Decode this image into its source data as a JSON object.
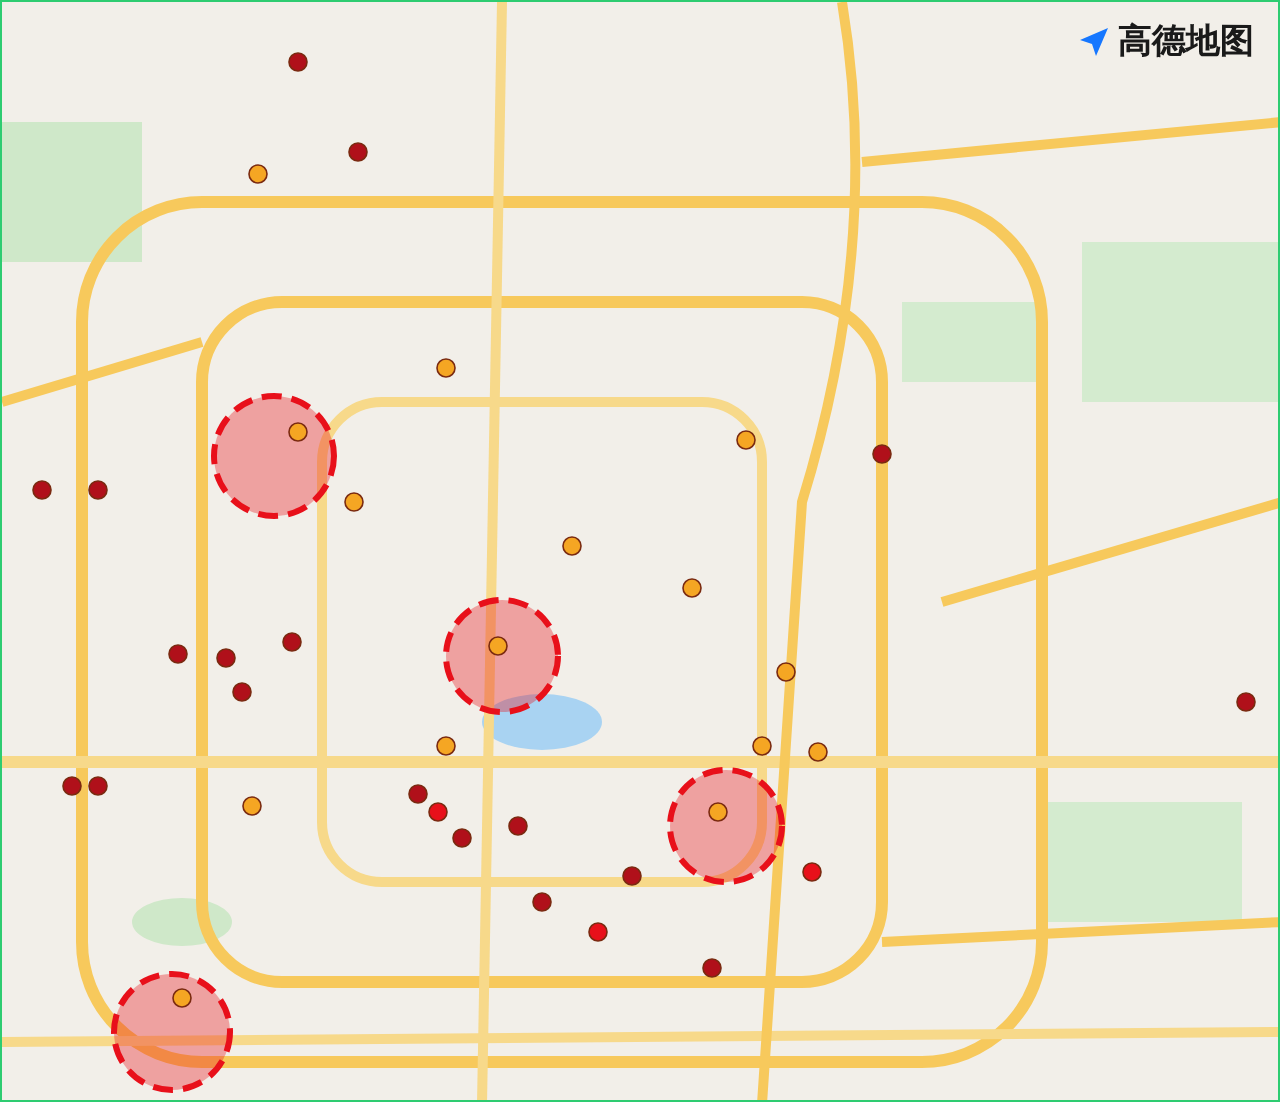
{
  "map": {
    "logo": {
      "text": "高德地图"
    },
    "markers": [
      {
        "kind": "cluster",
        "color": "#e8101a"
      },
      {
        "kind": "cluster",
        "color": "#e8101a"
      },
      {
        "kind": "cluster",
        "color": "#e8101a"
      },
      {
        "kind": "cluster",
        "color": "#e8101a"
      },
      {
        "kind": "dot",
        "color": "#b0101a"
      },
      {
        "kind": "dot",
        "color": "#b0101a"
      },
      {
        "kind": "dot",
        "color": "#b0101a"
      },
      {
        "kind": "dot",
        "color": "#b0101a"
      },
      {
        "kind": "dot",
        "color": "#b0101a"
      },
      {
        "kind": "dot",
        "color": "#b0101a"
      },
      {
        "kind": "dot",
        "color": "#b0101a"
      },
      {
        "kind": "dot",
        "color": "#b0101a"
      },
      {
        "kind": "dot",
        "color": "#b0101a"
      },
      {
        "kind": "dot",
        "color": "#b0101a"
      },
      {
        "kind": "dot",
        "color": "#b0101a"
      },
      {
        "kind": "dot",
        "color": "#b0101a"
      },
      {
        "kind": "dot",
        "color": "#b0101a"
      },
      {
        "kind": "dot",
        "color": "#b0101a"
      },
      {
        "kind": "dot",
        "color": "#b0101a"
      },
      {
        "kind": "dot",
        "color": "#b0101a"
      },
      {
        "kind": "dot",
        "color": "#b0101a"
      },
      {
        "kind": "dot",
        "color": "#b0101a"
      },
      {
        "kind": "dot",
        "color": "#f5a623"
      },
      {
        "kind": "dot",
        "color": "#f5a623"
      },
      {
        "kind": "dot",
        "color": "#f5a623"
      },
      {
        "kind": "dot",
        "color": "#f5a623"
      },
      {
        "kind": "dot",
        "color": "#f5a623"
      },
      {
        "kind": "dot",
        "color": "#f5a623"
      },
      {
        "kind": "dot",
        "color": "#f5a623"
      },
      {
        "kind": "dot",
        "color": "#f5a623"
      },
      {
        "kind": "dot",
        "color": "#f5a623"
      },
      {
        "kind": "dot",
        "color": "#f5a623"
      },
      {
        "kind": "dot",
        "color": "#f5a623"
      },
      {
        "kind": "dot",
        "color": "#f5a623"
      },
      {
        "kind": "dot",
        "color": "#f5a623"
      },
      {
        "kind": "dot",
        "color": "#f5a623"
      },
      {
        "kind": "dot",
        "color": "#f5a623"
      },
      {
        "kind": "dot",
        "color": "#e8101a"
      },
      {
        "kind": "dot",
        "color": "#e8101a"
      },
      {
        "kind": "dot",
        "color": "#e8101a"
      }
    ]
  }
}
